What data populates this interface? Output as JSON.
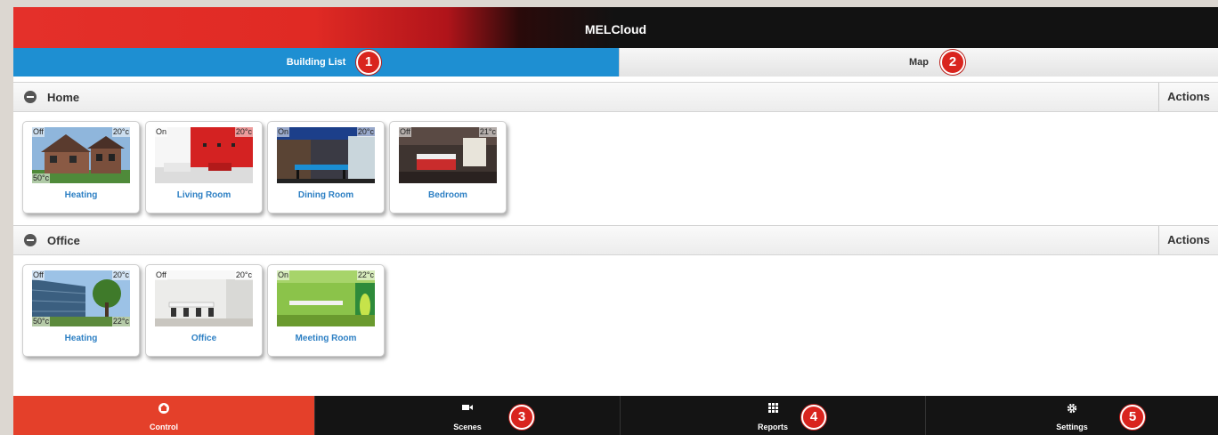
{
  "app": {
    "title": "MELCloud"
  },
  "tabs": [
    {
      "label": "Building List",
      "active": true,
      "callout": "1"
    },
    {
      "label": "Map",
      "active": false,
      "callout": "2"
    }
  ],
  "groups": [
    {
      "name": "Home",
      "actions_label": "Actions",
      "tiles": [
        {
          "label": "Heating",
          "status": "Off",
          "temp": "20°c",
          "tank": "50°c",
          "image": "house-exterior"
        },
        {
          "label": "Living Room",
          "status": "On",
          "temp": "20°c",
          "image": "red-living-room"
        },
        {
          "label": "Dining Room",
          "status": "On",
          "temp": "20°c",
          "image": "dining-room"
        },
        {
          "label": "Bedroom",
          "status": "Off",
          "temp": "21°c",
          "image": "bedroom"
        }
      ]
    },
    {
      "name": "Office",
      "actions_label": "Actions",
      "tiles": [
        {
          "label": "Heating",
          "status": "Off",
          "temp": "20°c",
          "tank": "50°c",
          "room": "22°c",
          "image": "glass-building"
        },
        {
          "label": "Office",
          "status": "Off",
          "temp": "20°c",
          "image": "office-room"
        },
        {
          "label": "Meeting Room",
          "status": "On",
          "temp": "22°c",
          "image": "meeting-room"
        }
      ]
    }
  ],
  "bottom_nav": [
    {
      "label": "Control",
      "icon": "home-icon",
      "active": true
    },
    {
      "label": "Scenes",
      "icon": "camera-icon",
      "active": false,
      "callout": "3"
    },
    {
      "label": "Reports",
      "icon": "grid-icon",
      "active": false,
      "callout": "4"
    },
    {
      "label": "Settings",
      "icon": "gear-icon",
      "active": false,
      "callout": "5"
    }
  ],
  "colors": {
    "accent_red": "#e4402a",
    "tab_blue": "#1e8fd2",
    "callout_red": "#d9241e",
    "label_blue": "#2e80c4"
  }
}
